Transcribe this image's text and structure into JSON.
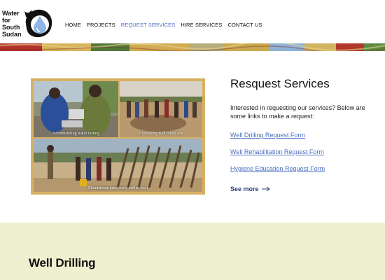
{
  "logo": {
    "text_lines": [
      "Water",
      "for",
      "South",
      "Sudan"
    ],
    "icon": "water-drop-logo-icon"
  },
  "nav": {
    "items": [
      {
        "label": "HOME",
        "active": false
      },
      {
        "label": "PROJECTS",
        "active": false
      },
      {
        "label": "REQUEST SERVICES",
        "active": true
      },
      {
        "label": "HIRE SERVICES",
        "active": false
      },
      {
        "label": "CONTACT US",
        "active": false
      }
    ]
  },
  "photos": {
    "captions": [
      "Administering water testing",
      "Evaluating well rehab site",
      "Maintaining previously drilled well"
    ]
  },
  "services": {
    "title": "Resquest Services",
    "intro": "Interested in requesting our services? Below are some links to make a request:",
    "links": [
      "Well Drilling Request Form",
      "Well Rehabilitation Request Form",
      "Hygiene Education Request Form"
    ],
    "more_label": "See more",
    "more_icon": "arrow-right-icon"
  },
  "well_section": {
    "title": "Well Drilling"
  },
  "colors": {
    "accent_link": "#4a6fbf",
    "photo_frame": "#d8b063",
    "section_bg": "#eef0cf"
  }
}
